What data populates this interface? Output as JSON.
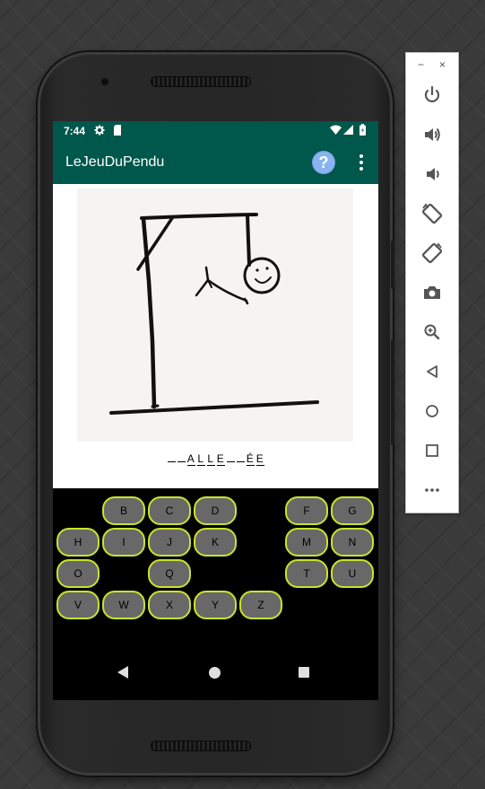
{
  "status_bar": {
    "time": "7:44",
    "left_icons": [
      "gear-icon",
      "sd-card-icon"
    ],
    "right_icons": [
      "wifi-icon",
      "signal-icon",
      "battery-icon"
    ]
  },
  "app_bar": {
    "title": "LeJeuDuPendu",
    "help_label": "?",
    "more_icon": "more-vert-icon"
  },
  "word": {
    "letters": [
      "",
      "",
      "A",
      "L",
      "L",
      "E",
      "",
      "",
      "É",
      "E"
    ]
  },
  "keyboard": {
    "rows": [
      [
        "B",
        "C",
        "D",
        "F",
        "G"
      ],
      [
        "H",
        "I",
        "J",
        "K",
        "M",
        "N"
      ],
      [
        "O",
        "Q",
        "T",
        "U"
      ],
      [
        "V",
        "W",
        "X",
        "Y",
        "Z"
      ]
    ],
    "key_color": "#686868",
    "key_border_color": "#c9e32b"
  },
  "nav_bar": {
    "icons": [
      "back-icon",
      "home-icon",
      "recents-icon"
    ]
  },
  "colors": {
    "app_bar": "#00574b",
    "help_button": "#8ab4f0"
  },
  "emulator_toolbar": {
    "window_controls": [
      "−",
      "×"
    ],
    "buttons": [
      "power-icon",
      "volume-up-icon",
      "volume-down-icon",
      "rotate-left-icon",
      "rotate-right-icon",
      "camera-icon",
      "zoom-icon",
      "back-icon",
      "home-icon",
      "overview-icon",
      "more-icon"
    ]
  }
}
